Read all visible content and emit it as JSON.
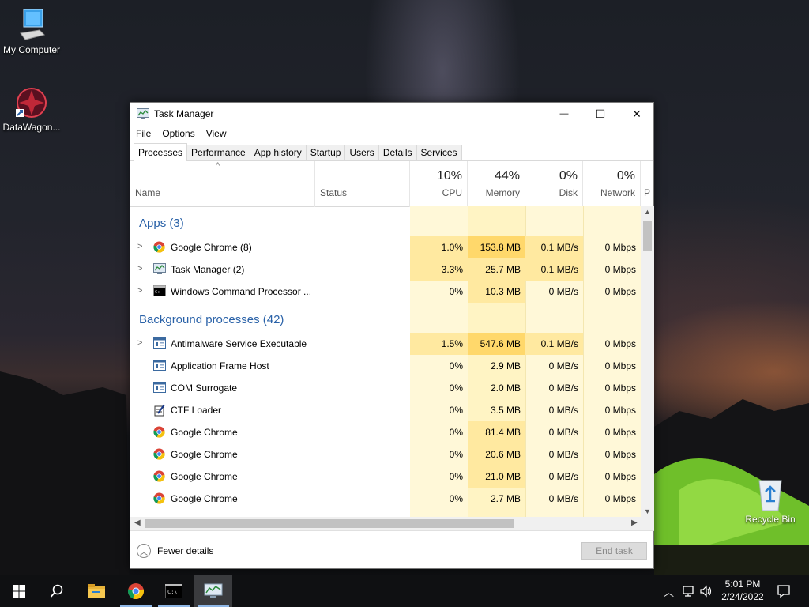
{
  "desktop": {
    "icons": [
      {
        "label": "My Computer"
      },
      {
        "label": "DataWagon..."
      },
      {
        "label": "Recycle Bin"
      }
    ]
  },
  "window": {
    "title": "Task Manager",
    "controls": {
      "minimize": "—",
      "maximize": "☐",
      "close": "✕"
    },
    "menu": [
      "File",
      "Options",
      "View"
    ],
    "tabs": [
      "Processes",
      "Performance",
      "App history",
      "Startup",
      "Users",
      "Details",
      "Services"
    ],
    "active_tab": "Processes",
    "columns": {
      "name": "Name",
      "status": "Status",
      "cpu": {
        "pct": "10%",
        "label": "CPU"
      },
      "memory": {
        "pct": "44%",
        "label": "Memory"
      },
      "disk": {
        "pct": "0%",
        "label": "Disk"
      },
      "network": {
        "pct": "0%",
        "label": "Network"
      },
      "power_partial": "P"
    },
    "groups": {
      "apps": "Apps (3)",
      "background": "Background processes (42)"
    },
    "apps": [
      {
        "name": "Google Chrome (8)",
        "icon": "chrome-icon",
        "expandable": true,
        "cpu": "1.0%",
        "memory": "153.8 MB",
        "disk": "0.1 MB/s",
        "network": "0 Mbps"
      },
      {
        "name": "Task Manager (2)",
        "icon": "task-manager-icon",
        "expandable": true,
        "cpu": "3.3%",
        "memory": "25.7 MB",
        "disk": "0.1 MB/s",
        "network": "0 Mbps"
      },
      {
        "name": "Windows Command Processor ...",
        "icon": "cmd-icon",
        "expandable": true,
        "cpu": "0%",
        "memory": "10.3 MB",
        "disk": "0 MB/s",
        "network": "0 Mbps"
      }
    ],
    "background": [
      {
        "name": "Antimalware Service Executable",
        "icon": "service-icon",
        "expandable": true,
        "cpu": "1.5%",
        "memory": "547.6 MB",
        "disk": "0.1 MB/s",
        "network": "0 Mbps"
      },
      {
        "name": "Application Frame Host",
        "icon": "service-icon",
        "expandable": false,
        "cpu": "0%",
        "memory": "2.9 MB",
        "disk": "0 MB/s",
        "network": "0 Mbps"
      },
      {
        "name": "COM Surrogate",
        "icon": "service-icon",
        "expandable": false,
        "cpu": "0%",
        "memory": "2.0 MB",
        "disk": "0 MB/s",
        "network": "0 Mbps"
      },
      {
        "name": "CTF Loader",
        "icon": "ctf-icon",
        "expandable": false,
        "cpu": "0%",
        "memory": "3.5 MB",
        "disk": "0 MB/s",
        "network": "0 Mbps"
      },
      {
        "name": "Google Chrome",
        "icon": "chrome-icon",
        "expandable": false,
        "cpu": "0%",
        "memory": "81.4 MB",
        "disk": "0 MB/s",
        "network": "0 Mbps"
      },
      {
        "name": "Google Chrome",
        "icon": "chrome-icon",
        "expandable": false,
        "cpu": "0%",
        "memory": "20.6 MB",
        "disk": "0 MB/s",
        "network": "0 Mbps"
      },
      {
        "name": "Google Chrome",
        "icon": "chrome-icon",
        "expandable": false,
        "cpu": "0%",
        "memory": "21.0 MB",
        "disk": "0 MB/s",
        "network": "0 Mbps"
      },
      {
        "name": "Google Chrome",
        "icon": "chrome-icon",
        "expandable": false,
        "cpu": "0%",
        "memory": "2.7 MB",
        "disk": "0 MB/s",
        "network": "0 Mbps"
      }
    ],
    "footer": {
      "fewer_details": "Fewer details",
      "end_task": "End task"
    }
  },
  "taskbar": {
    "items": [
      "windows-start-icon",
      "search-icon",
      "file-explorer-icon",
      "chrome-icon",
      "cmd-icon",
      "task-manager-icon"
    ],
    "clock": {
      "time": "5:01 PM",
      "date": "2/24/2022"
    }
  },
  "colors": {
    "group_header": "#2a62a8",
    "heat_light": "#fff4c4",
    "heat_mid": "#ffe9a0",
    "heat_strong": "#ffd86b",
    "accent": "#0078d7"
  }
}
